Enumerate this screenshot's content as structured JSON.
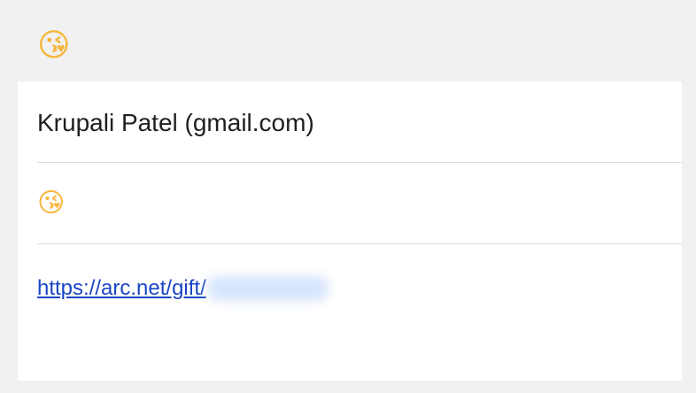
{
  "header": {
    "emoji": "😘"
  },
  "message": {
    "sender": "Krupali Patel (gmail.com)",
    "emoji": "😘",
    "link_text": "https://arc.net/gift/"
  },
  "icons": {
    "header_emoji": "kissing-face-icon",
    "body_emoji": "kissing-face-icon"
  },
  "colors": {
    "background": "#f1f1f1",
    "card": "#ffffff",
    "link": "#1a45c6",
    "divider": "#dddddd"
  }
}
